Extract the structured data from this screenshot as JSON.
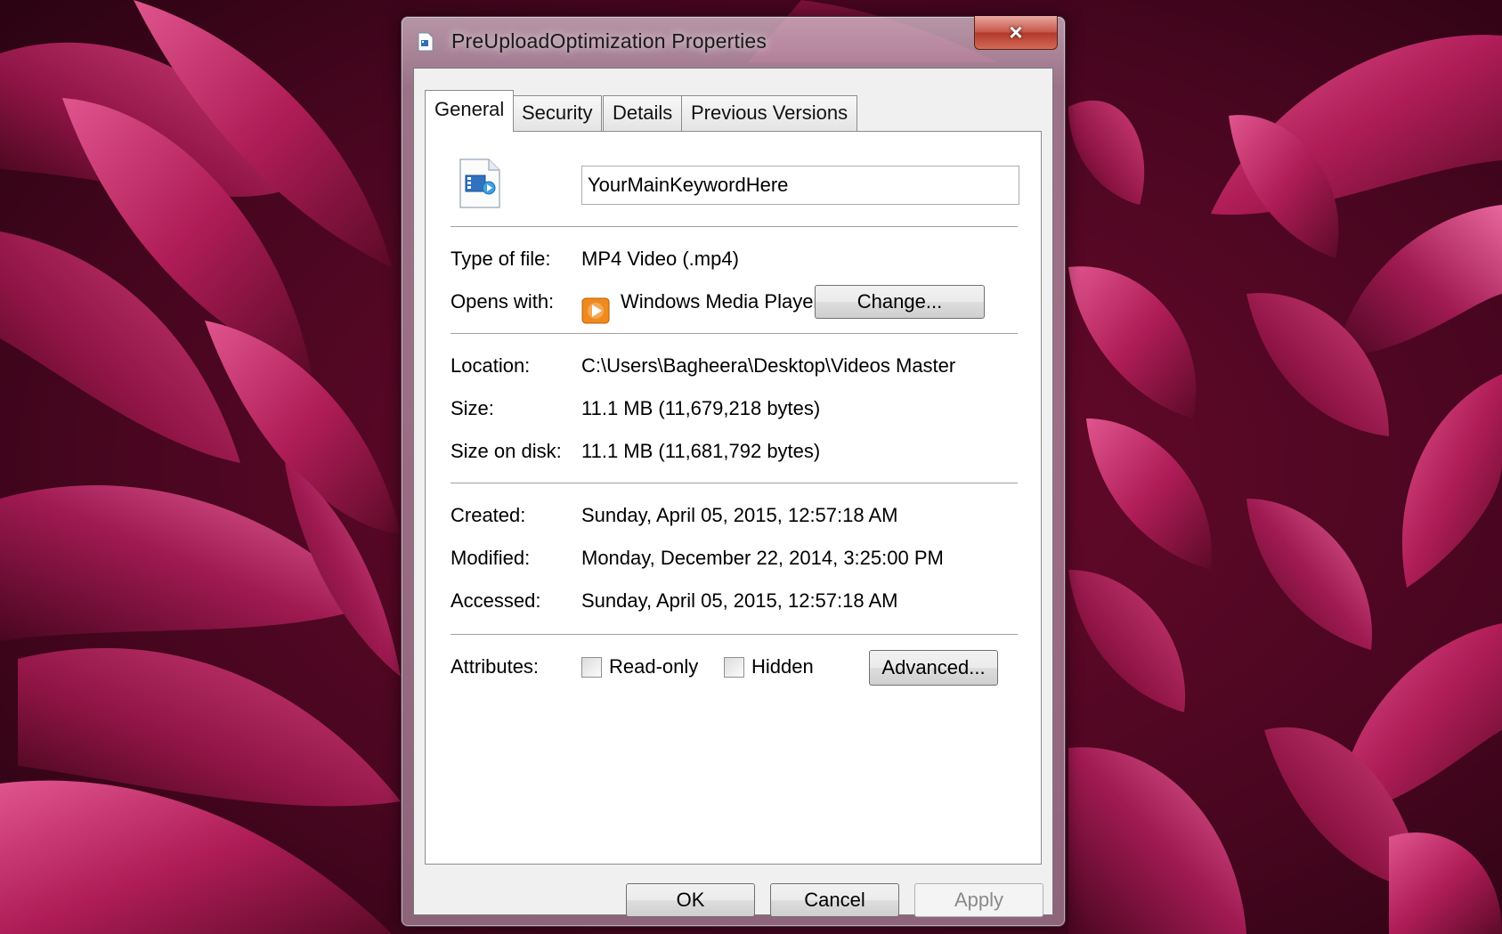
{
  "window": {
    "title": "PreUploadOptimization Properties",
    "close_label": "×"
  },
  "tabs": [
    {
      "label": "General",
      "active": true
    },
    {
      "label": "Security",
      "active": false
    },
    {
      "label": "Details",
      "active": false
    },
    {
      "label": "Previous Versions",
      "active": false
    }
  ],
  "general": {
    "file_name": "YourMainKeywordHere",
    "type_label": "Type of file:",
    "type_value": "MP4 Video (.mp4)",
    "opens_label": "Opens with:",
    "opens_value": "Windows Media Player",
    "change_button": "Change...",
    "location_label": "Location:",
    "location_value": "C:\\Users\\Bagheera\\Desktop\\Videos Master",
    "size_label": "Size:",
    "size_value": "11.1 MB (11,679,218 bytes)",
    "size_on_disk_label": "Size on disk:",
    "size_on_disk_value": "11.1 MB (11,681,792 bytes)",
    "created_label": "Created:",
    "created_value": "Sunday, April 05, 2015, 12:57:18 AM",
    "modified_label": "Modified:",
    "modified_value": "Monday, December 22, 2014, 3:25:00 PM",
    "accessed_label": "Accessed:",
    "accessed_value": "Sunday, April 05, 2015, 12:57:18 AM",
    "attributes_label": "Attributes:",
    "readonly_label": "Read-only",
    "readonly_checked": false,
    "hidden_label": "Hidden",
    "hidden_checked": false,
    "advanced_button": "Advanced..."
  },
  "footer": {
    "ok": "OK",
    "cancel": "Cancel",
    "apply": "Apply"
  },
  "colors": {
    "wallpaper_dark": "#3d0416",
    "wallpaper_petal": "#b01d58",
    "close_red": "#c8584a"
  },
  "icons": {
    "title": "video-file-icon",
    "file": "video-file-icon",
    "opens_with": "windows-media-player-icon"
  }
}
